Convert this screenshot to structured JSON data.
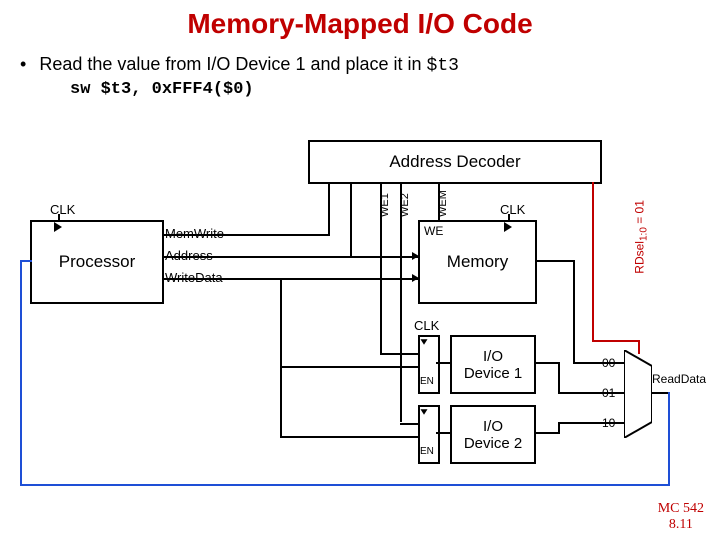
{
  "title": "Memory-Mapped I/O Code",
  "bullet": {
    "text_prefix": "Read the value from I/O Device 1 and place it in ",
    "reg": "$t3"
  },
  "code": "sw $t3, 0xFFF4($0)",
  "diagram": {
    "processor": "Processor",
    "address_decoder": "Address Decoder",
    "memory": "Memory",
    "io1": "I/O\nDevice 1",
    "io2": "I/O\nDevice 2",
    "clk": "CLK",
    "memwrite": "MemWrite",
    "address": "Address",
    "writedata": "WriteData",
    "we": "WE",
    "en": "EN",
    "we1": "WE1",
    "we2": "WE2",
    "wem": "WEM",
    "rdsel": "RDsel",
    "rdsel_sub": "1:0",
    "rdsel_eq": " = 01",
    "readdata": "ReadData",
    "mux_labels": [
      "00",
      "01",
      "10"
    ]
  },
  "footer": {
    "course": "MC 542",
    "page": "8.11"
  }
}
